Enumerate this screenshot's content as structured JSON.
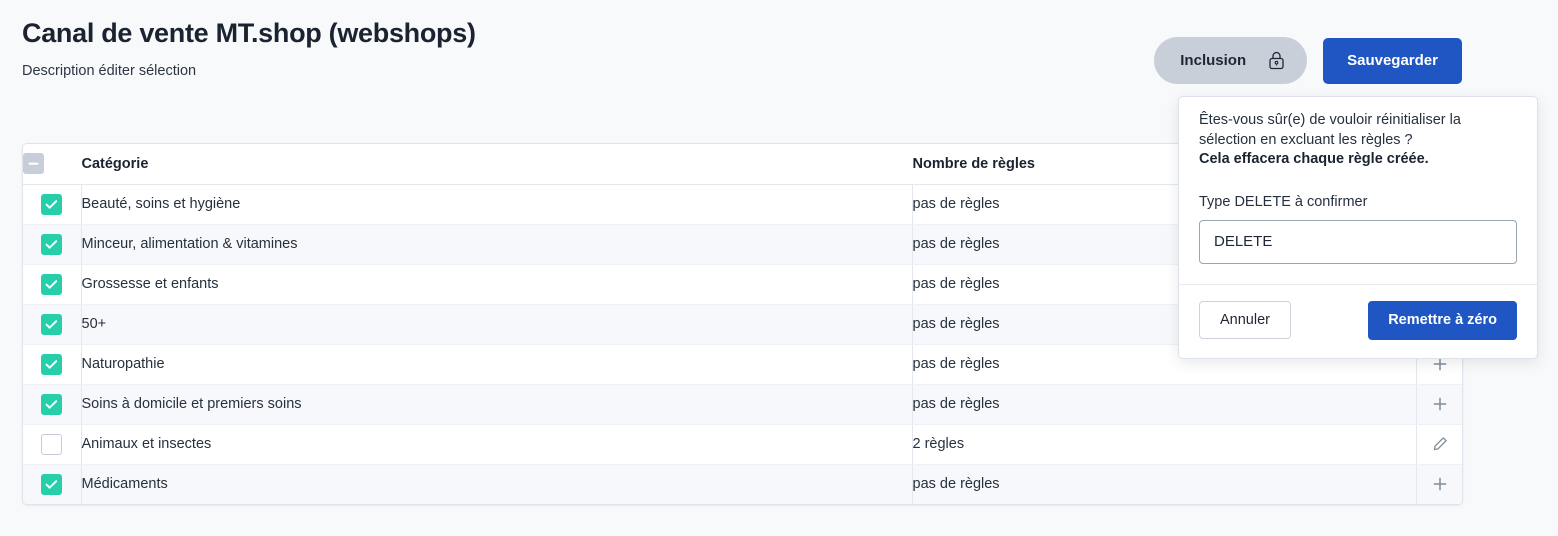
{
  "header": {
    "title": "Canal de vente MT.shop (webshops)",
    "subtitle": "Description éditer sélection",
    "inclusion_label": "Inclusion",
    "inclusion_icon": "lock-icon",
    "save_label": "Sauvegarder"
  },
  "colors": {
    "primary_blue": "#1f56c4",
    "checkbox_green": "#27ceaa",
    "pill_gray": "#c9cfd9",
    "page_background": "#f8f9fb",
    "row_stripe": "#f7f8fb"
  },
  "table": {
    "header_checkbox_state": "indeterminate",
    "columns": [
      "",
      "Catégorie",
      "Nombre de règles",
      ""
    ],
    "rows": [
      {
        "checked": true,
        "category": "Beauté, soins et hygiène",
        "rules": "pas de règles",
        "action": "add-icon"
      },
      {
        "checked": true,
        "category": "Minceur, alimentation & vitamines",
        "rules": "pas de règles",
        "action": "add-icon"
      },
      {
        "checked": true,
        "category": "Grossesse et enfants",
        "rules": "pas de règles",
        "action": "add-icon"
      },
      {
        "checked": true,
        "category": "50+",
        "rules": "pas de règles",
        "action": "add-icon"
      },
      {
        "checked": true,
        "category": "Naturopathie",
        "rules": "pas de règles",
        "action": "add-icon"
      },
      {
        "checked": true,
        "category": "Soins à domicile et premiers soins",
        "rules": "pas de règles",
        "action": "add-icon"
      },
      {
        "checked": false,
        "category": "Animaux et insectes",
        "rules": "2 règles",
        "action": "edit-icon"
      },
      {
        "checked": true,
        "category": "Médicaments",
        "rules": "pas de règles",
        "action": "add-icon"
      }
    ]
  },
  "popover": {
    "question": "Êtes-vous sûr(e) de vouloir réinitialiser la sélection en excluant les règles ?",
    "warning": "Cela effacera chaque règle créée.",
    "input_label": "Type DELETE à confirmer",
    "input_value": "DELETE",
    "input_placeholder": "",
    "cancel_label": "Annuler",
    "confirm_label": "Remettre à zéro"
  }
}
